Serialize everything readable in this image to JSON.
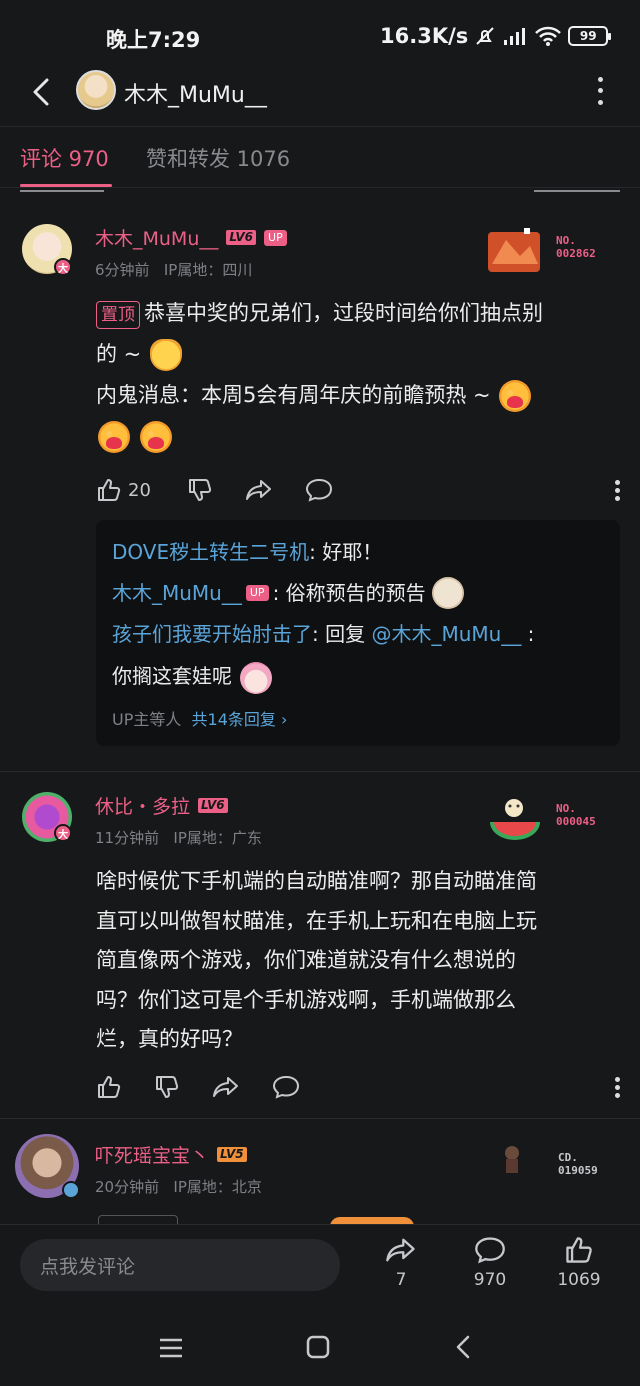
{
  "status": {
    "time": "晚上7:29",
    "speed": "16.3K/s",
    "battery": "99"
  },
  "header": {
    "title": "木木_MuMu__"
  },
  "tabs": [
    {
      "label": "评论 970"
    },
    {
      "label": "赞和转发 1076"
    }
  ],
  "comments": [
    {
      "username": "木木_MuMu__",
      "level": "LV6",
      "up_tag": "UP",
      "avatar_badge": "大",
      "time": "6分钟前",
      "ip": "IP属地：四川",
      "fan_label": "NO.",
      "fan_no": "002862",
      "pin": "置顶",
      "line1": "恭喜中奖的兄弟们，过段时间给你们抽点别",
      "line2": "的 ~",
      "line3": "内鬼消息：本周5会有周年庆的前瞻预热 ~",
      "likes": "20",
      "replies": [
        {
          "name": "DOVE秽土转生二号机",
          "text": ": 好耶！"
        },
        {
          "name": "木木_MuMu__",
          "tag": "UP",
          "text": ": 俗称预告的预告"
        },
        {
          "name": "孩子们我要开始肘击了",
          "text": ": 回复 ",
          "mention": "@木木_MuMu__",
          "text2": " :"
        },
        {
          "text": "你搁这套娃呢"
        }
      ],
      "reply_summary": "UP主等人",
      "reply_count": "共14条回复"
    },
    {
      "username": "休比・多拉",
      "level": "LV6",
      "avatar_badge": "大",
      "time": "11分钟前",
      "ip": "IP属地：广东",
      "fan_label": "NO.",
      "fan_no": "000045",
      "lines": [
        "啥时候优下手机端的自动瞄准啊？那自动瞄准简",
        "直可以叫做智杖瞄准，在手机上玩和在电脑上玩",
        "简直像两个游戏，你们难道就没有什么想说的",
        "吗？你们这可是个手机游戏啊，手机端做那么",
        "烂，真的好吗？"
      ]
    },
    {
      "username": "吓死瑶宝宝丶",
      "level": "LV5",
      "time": "20分钟前",
      "ip": "IP属地：北京",
      "fan_label": "CD.",
      "fan_no": "019059"
    }
  ],
  "bottom": {
    "placeholder": "点我发评论",
    "share_count": "7",
    "comment_count": "970",
    "like_count": "1069"
  },
  "colors": {
    "accent": "#ec5f86",
    "link": "#5aa4d8",
    "background": "#17181a"
  }
}
